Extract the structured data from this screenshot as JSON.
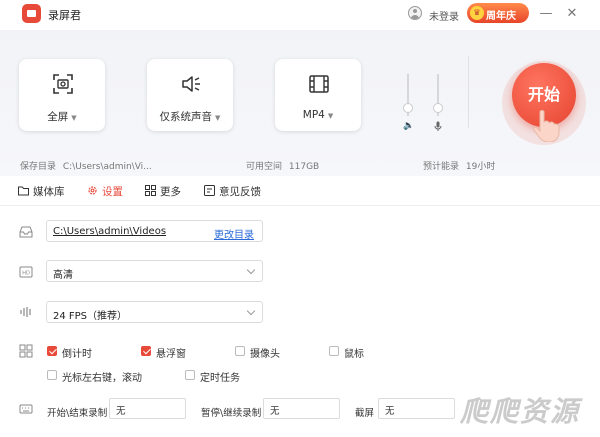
{
  "titlebar": {
    "app_title": "录屏君",
    "login_text": "未登录",
    "anniversary_label": "周年庆",
    "crown_glyph": "♛",
    "minimize_glyph": "—",
    "close_glyph": "✕"
  },
  "record_options": [
    {
      "label": "全屏",
      "icon": "screen-capture-icon"
    },
    {
      "label": "仅系统声音",
      "icon": "speaker-icon"
    },
    {
      "label": "MP4",
      "icon": "film-icon"
    }
  ],
  "caret_glyph": "▼",
  "volume": {
    "speaker_level": 0.1,
    "mic_level": 0.1
  },
  "start_button": {
    "label": "开始"
  },
  "info": {
    "save_dir_label": "保存目录",
    "save_dir_value": "C:\\Users\\admin\\Vi...",
    "free_space_label": "可用空间",
    "free_space_value": "117GB",
    "estimate_label": "预计能录",
    "estimate_value": "19小时"
  },
  "tabs": [
    {
      "label": "媒体库",
      "icon": "folder-icon"
    },
    {
      "label": "设置",
      "icon": "gear-icon",
      "active": true
    },
    {
      "label": "更多",
      "icon": "grid-icon"
    },
    {
      "label": "意见反馈",
      "icon": "feedback-icon"
    }
  ],
  "settings": {
    "save_path": "C:\\Users\\admin\\Videos",
    "change_dir_link": "更改目录",
    "quality": "高清",
    "fps": "24 FPS（推荐）",
    "options": [
      {
        "label": "倒计时",
        "checked": true
      },
      {
        "label": "悬浮窗",
        "checked": true
      },
      {
        "label": "摄像头",
        "checked": false
      },
      {
        "label": "鼠标",
        "checked": false
      },
      {
        "label": "光标左右键，滚动",
        "checked": false
      },
      {
        "label": "定时任务",
        "checked": false
      }
    ],
    "hotkeys": [
      {
        "label": "开始\\结束录制",
        "value": "无"
      },
      {
        "label": "暂停\\继续录制",
        "value": "无"
      },
      {
        "label": "截屏",
        "value": "无"
      }
    ]
  },
  "watermark": "爬爬资源",
  "colors": {
    "accent": "#e84a3a",
    "link": "#2b6ad8"
  }
}
